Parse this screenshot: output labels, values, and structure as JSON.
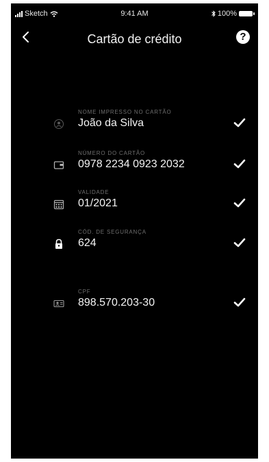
{
  "status_bar": {
    "carrier": "Sketch",
    "time": "9:41 AM",
    "battery": "100%"
  },
  "header": {
    "title": "Cartão de crédito",
    "help_label": "?"
  },
  "fields": [
    {
      "label": "Nome impresso no cartão",
      "value": "João da Silva",
      "icon": "person-icon",
      "valid": true
    },
    {
      "label": "Número do cartão",
      "value": "0978 2234 0923 2032",
      "icon": "credit-card-icon",
      "valid": true
    },
    {
      "label": "Validade",
      "value": "01/2021",
      "icon": "calendar-icon",
      "valid": true
    },
    {
      "label": "Cód. de segurança",
      "value": "624",
      "icon": "lock-icon",
      "valid": true
    },
    {
      "label": "CPF",
      "value": "898.570.203-30",
      "icon": "id-card-icon",
      "valid": true
    }
  ],
  "colors": {
    "background": "#000000",
    "text": "#ffffff",
    "label": "#6e6e6e",
    "icon": "#9a9a9a"
  }
}
